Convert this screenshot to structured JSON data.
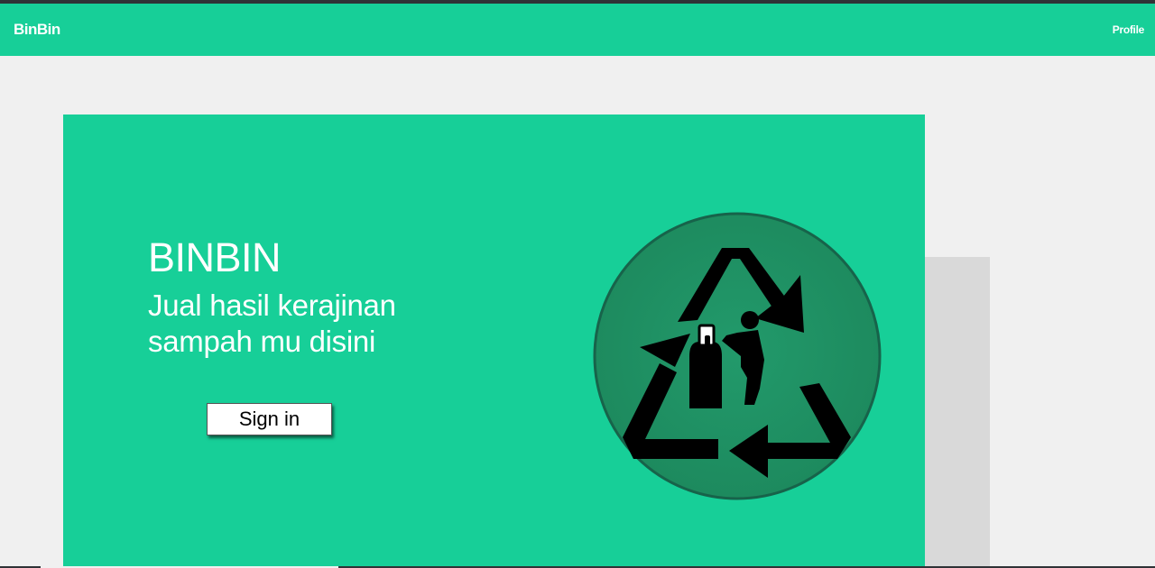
{
  "navbar": {
    "brand": "BinBin",
    "profile_label": "Profile",
    "color": "#17cf98"
  },
  "hero": {
    "title": "BINBIN",
    "subtitle": "Jual hasil kerajinan sampah mu disini",
    "signin_label": "Sign in",
    "background": "#17cf98",
    "emblem_icon": "recycle-icon",
    "emblem_color": "#1f8f63"
  }
}
